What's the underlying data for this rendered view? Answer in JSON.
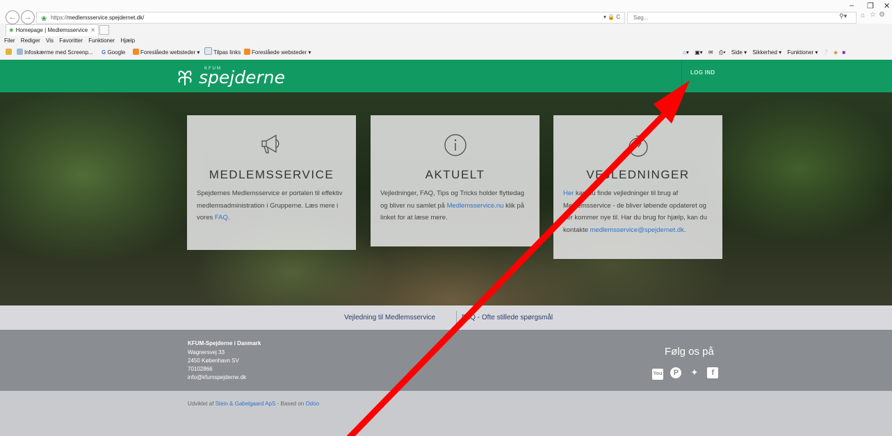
{
  "browser": {
    "url_prefix": "https://",
    "url_host": "medlemsservice.spejdernet.dk/",
    "address_tools": "▾ 🔒 C",
    "search_placeholder": "Søg...",
    "window_controls": [
      "–",
      "❐",
      "✕"
    ],
    "tab_title": "Homepage | Medlemsservice",
    "tab_close": "✕",
    "menu": [
      "Filer",
      "Rediger",
      "Vis",
      "Favoritter",
      "Funktioner",
      "Hjælp"
    ],
    "favorites": [
      "Infoskærme med Screenp...",
      "Google",
      "Foreslåede websteder ▾",
      "Tilpas links",
      "Foreslåede websteder ▾"
    ],
    "command_bar": [
      "▾",
      "▾",
      "▾",
      "Side ▾",
      "Sikkerhed ▾",
      "Funktioner ▾"
    ]
  },
  "site": {
    "brand_small": "KFUM",
    "brand": "spejderne",
    "login": "LOG IND"
  },
  "cards": [
    {
      "icon": "megaphone-icon",
      "title": "MEDLEMSSERVICE",
      "text_before": "Spejdernes Medlemsservice er portalen til effektiv medlemsadministration i Grupperne. Læs mere i vores ",
      "link": "FAQ",
      "text_after": "."
    },
    {
      "icon": "info-icon",
      "title": "AKTUELT",
      "text_before": "Vejledninger, FAQ, Tips og Tricks holder flyttedag og bliver nu samlet på ",
      "link": "Medlemsservice.nu",
      "text_after": " klik på linket for at læse mere."
    },
    {
      "icon": "stopwatch-icon",
      "title": "VEJLEDNINGER",
      "link": "Her",
      "text_after": " kan du finde vejledninger til brug af Medlemsservice - de bliver løbende opdateret og der kommer nye til. Har du brug for hjælp, kan du kontakte ",
      "link2": "medlemsservice@spejdernet.dk",
      "text_end": "."
    }
  ],
  "links_bar": {
    "link1": "Vejledning til Medlemsservice",
    "link2": "FAQ - Ofte stillede spørgsmål"
  },
  "footer": {
    "org": "KFUM-Spejderne i Danmark",
    "street": "Wagnersvej 33",
    "city": "2450 København SV",
    "phone": "70102866",
    "email": "info@kfumspejderne.dk",
    "follow": "Følg os på",
    "social": [
      "youtube-icon",
      "pinterest-icon",
      "twitter-icon",
      "facebook-icon"
    ]
  },
  "bottom": {
    "credit_before": "Udviklet af ",
    "credit_link": "Stein & Gabelgaard ApS",
    "credit_mid": " - Based on ",
    "credit_link2": "Odoo"
  },
  "colors": {
    "brand_green": "#129a63",
    "annotation_arrow": "#ff0000"
  }
}
